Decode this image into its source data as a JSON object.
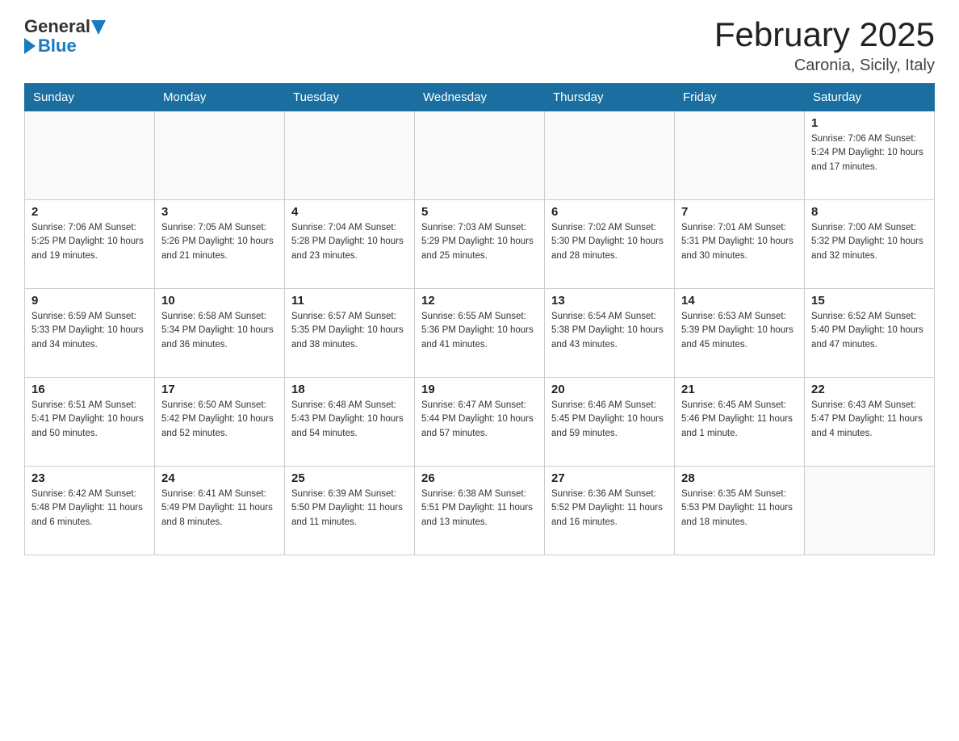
{
  "header": {
    "logo_general": "General",
    "logo_blue": "Blue",
    "title": "February 2025",
    "subtitle": "Caronia, Sicily, Italy"
  },
  "days_of_week": [
    "Sunday",
    "Monday",
    "Tuesday",
    "Wednesday",
    "Thursday",
    "Friday",
    "Saturday"
  ],
  "weeks": [
    {
      "days": [
        {
          "number": "",
          "info": ""
        },
        {
          "number": "",
          "info": ""
        },
        {
          "number": "",
          "info": ""
        },
        {
          "number": "",
          "info": ""
        },
        {
          "number": "",
          "info": ""
        },
        {
          "number": "",
          "info": ""
        },
        {
          "number": "1",
          "info": "Sunrise: 7:06 AM\nSunset: 5:24 PM\nDaylight: 10 hours\nand 17 minutes."
        }
      ]
    },
    {
      "days": [
        {
          "number": "2",
          "info": "Sunrise: 7:06 AM\nSunset: 5:25 PM\nDaylight: 10 hours\nand 19 minutes."
        },
        {
          "number": "3",
          "info": "Sunrise: 7:05 AM\nSunset: 5:26 PM\nDaylight: 10 hours\nand 21 minutes."
        },
        {
          "number": "4",
          "info": "Sunrise: 7:04 AM\nSunset: 5:28 PM\nDaylight: 10 hours\nand 23 minutes."
        },
        {
          "number": "5",
          "info": "Sunrise: 7:03 AM\nSunset: 5:29 PM\nDaylight: 10 hours\nand 25 minutes."
        },
        {
          "number": "6",
          "info": "Sunrise: 7:02 AM\nSunset: 5:30 PM\nDaylight: 10 hours\nand 28 minutes."
        },
        {
          "number": "7",
          "info": "Sunrise: 7:01 AM\nSunset: 5:31 PM\nDaylight: 10 hours\nand 30 minutes."
        },
        {
          "number": "8",
          "info": "Sunrise: 7:00 AM\nSunset: 5:32 PM\nDaylight: 10 hours\nand 32 minutes."
        }
      ]
    },
    {
      "days": [
        {
          "number": "9",
          "info": "Sunrise: 6:59 AM\nSunset: 5:33 PM\nDaylight: 10 hours\nand 34 minutes."
        },
        {
          "number": "10",
          "info": "Sunrise: 6:58 AM\nSunset: 5:34 PM\nDaylight: 10 hours\nand 36 minutes."
        },
        {
          "number": "11",
          "info": "Sunrise: 6:57 AM\nSunset: 5:35 PM\nDaylight: 10 hours\nand 38 minutes."
        },
        {
          "number": "12",
          "info": "Sunrise: 6:55 AM\nSunset: 5:36 PM\nDaylight: 10 hours\nand 41 minutes."
        },
        {
          "number": "13",
          "info": "Sunrise: 6:54 AM\nSunset: 5:38 PM\nDaylight: 10 hours\nand 43 minutes."
        },
        {
          "number": "14",
          "info": "Sunrise: 6:53 AM\nSunset: 5:39 PM\nDaylight: 10 hours\nand 45 minutes."
        },
        {
          "number": "15",
          "info": "Sunrise: 6:52 AM\nSunset: 5:40 PM\nDaylight: 10 hours\nand 47 minutes."
        }
      ]
    },
    {
      "days": [
        {
          "number": "16",
          "info": "Sunrise: 6:51 AM\nSunset: 5:41 PM\nDaylight: 10 hours\nand 50 minutes."
        },
        {
          "number": "17",
          "info": "Sunrise: 6:50 AM\nSunset: 5:42 PM\nDaylight: 10 hours\nand 52 minutes."
        },
        {
          "number": "18",
          "info": "Sunrise: 6:48 AM\nSunset: 5:43 PM\nDaylight: 10 hours\nand 54 minutes."
        },
        {
          "number": "19",
          "info": "Sunrise: 6:47 AM\nSunset: 5:44 PM\nDaylight: 10 hours\nand 57 minutes."
        },
        {
          "number": "20",
          "info": "Sunrise: 6:46 AM\nSunset: 5:45 PM\nDaylight: 10 hours\nand 59 minutes."
        },
        {
          "number": "21",
          "info": "Sunrise: 6:45 AM\nSunset: 5:46 PM\nDaylight: 11 hours\nand 1 minute."
        },
        {
          "number": "22",
          "info": "Sunrise: 6:43 AM\nSunset: 5:47 PM\nDaylight: 11 hours\nand 4 minutes."
        }
      ]
    },
    {
      "days": [
        {
          "number": "23",
          "info": "Sunrise: 6:42 AM\nSunset: 5:48 PM\nDaylight: 11 hours\nand 6 minutes."
        },
        {
          "number": "24",
          "info": "Sunrise: 6:41 AM\nSunset: 5:49 PM\nDaylight: 11 hours\nand 8 minutes."
        },
        {
          "number": "25",
          "info": "Sunrise: 6:39 AM\nSunset: 5:50 PM\nDaylight: 11 hours\nand 11 minutes."
        },
        {
          "number": "26",
          "info": "Sunrise: 6:38 AM\nSunset: 5:51 PM\nDaylight: 11 hours\nand 13 minutes."
        },
        {
          "number": "27",
          "info": "Sunrise: 6:36 AM\nSunset: 5:52 PM\nDaylight: 11 hours\nand 16 minutes."
        },
        {
          "number": "28",
          "info": "Sunrise: 6:35 AM\nSunset: 5:53 PM\nDaylight: 11 hours\nand 18 minutes."
        },
        {
          "number": "",
          "info": ""
        }
      ]
    }
  ]
}
